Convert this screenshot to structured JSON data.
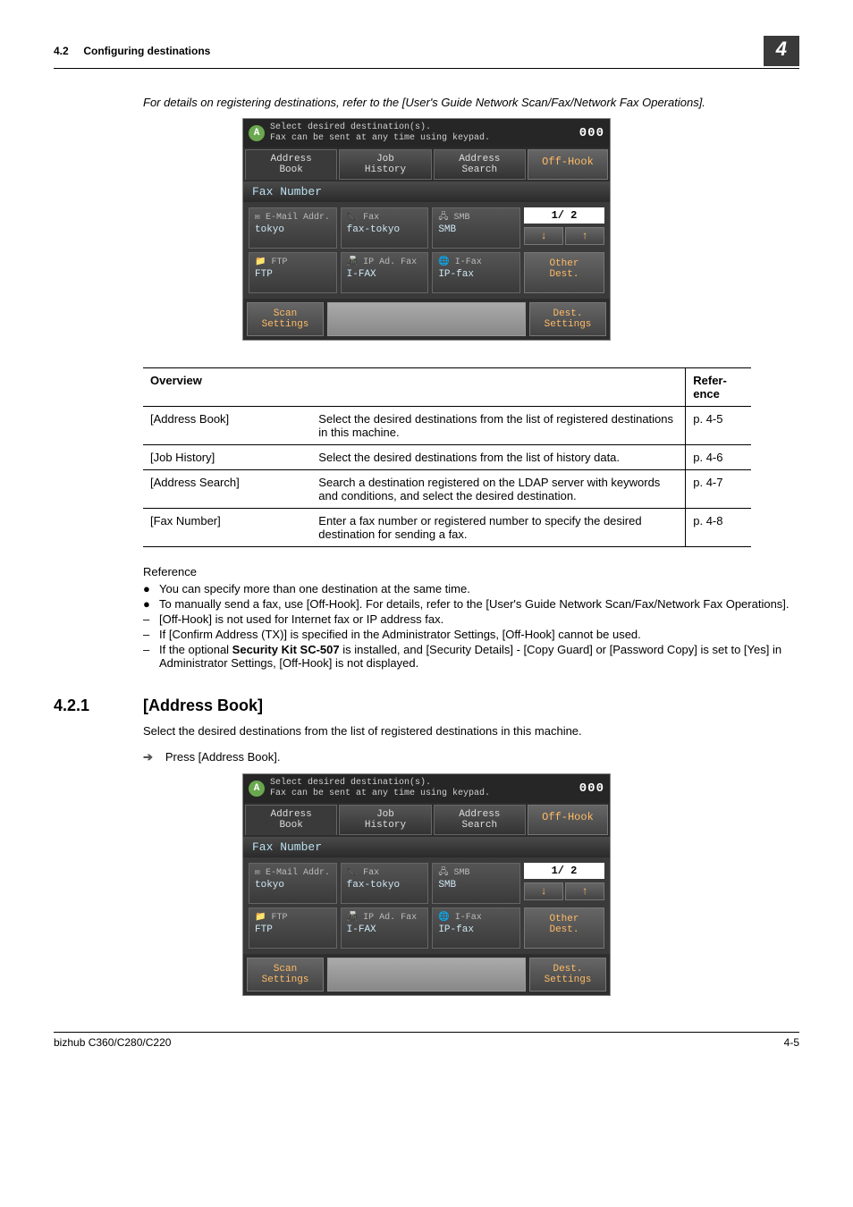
{
  "header": {
    "section_number": "4.2",
    "section_title": "Configuring destinations",
    "chapter_number": "4"
  },
  "intro_note": "For details on registering destinations, refer to the [User's Guide Network Scan/Fax/Network Fax Operations].",
  "screenshot": {
    "top_line1": "Select desired destination(s).",
    "top_line2": "Fax can be sent at any time using keypad.",
    "memory": "000",
    "tabs": {
      "book": "Address\nBook",
      "history": "Job\nHistory",
      "search": "Address\nSearch"
    },
    "offhook": "Off-Hook",
    "fax_number_label": "Fax Number",
    "cells": {
      "email_lbl": "E-Mail Addr.",
      "email_val": "tokyo",
      "fax_lbl": "Fax",
      "fax_val": "fax-tokyo",
      "smb_lbl": "SMB",
      "smb_val": "SMB",
      "ftp_lbl": "FTP",
      "ftp_val": "FTP",
      "ipad_lbl": "IP Ad. Fax",
      "ipad_val": "I-FAX",
      "ifax_lbl": "I-Fax",
      "ifax_val": "IP-fax"
    },
    "pager": "1/  2",
    "other_dest": "Other\nDest.",
    "scan_settings": "Scan\nSettings",
    "dest_settings": "Dest.\nSettings"
  },
  "table": {
    "headers": {
      "overview": "Overview",
      "reference": "Refer-\nence"
    },
    "rows": [
      {
        "item": "[Address Book]",
        "desc": "Select the desired destinations from the list of registered destinations in this machine.",
        "ref": "p. 4-5"
      },
      {
        "item": "[Job History]",
        "desc": "Select the desired destinations from the list of history data.",
        "ref": "p. 4-6"
      },
      {
        "item": "[Address Search]",
        "desc": "Search a destination registered on the LDAP server with keywords and conditions, and select the desired destination.",
        "ref": "p. 4-7"
      },
      {
        "item": "[Fax Number]",
        "desc": "Enter a fax number or registered number to specify the desired destination for sending a fax.",
        "ref": "p. 4-8"
      }
    ]
  },
  "reference": {
    "label": "Reference",
    "items": [
      {
        "marker": "●",
        "text": "You can specify more than one destination at the same time."
      },
      {
        "marker": "●",
        "text": "To manually send a fax, use [Off-Hook]. For details, refer to the [User's Guide Network Scan/Fax/Network Fax Operations]."
      },
      {
        "marker": "–",
        "text": "[Off-Hook] is not used for Internet fax or IP address fax."
      },
      {
        "marker": "–",
        "text": "If [Confirm Address (TX)] is specified in the Administrator Settings, [Off-Hook] cannot be used."
      },
      {
        "marker": "–",
        "html": "If the optional <b>Security Kit SC-507</b> is installed, and [Security Details] - [Copy Guard] or [Password Copy] is set to [Yes] in Administrator Settings, [Off-Hook] is not displayed."
      }
    ]
  },
  "subsection": {
    "number": "4.2.1",
    "title": "[Address Book]",
    "body": "Select the desired destinations from the list of registered destinations in this machine.",
    "step": "Press [Address Book]."
  },
  "footer": {
    "left": "bizhub C360/C280/C220",
    "right": "4-5"
  }
}
